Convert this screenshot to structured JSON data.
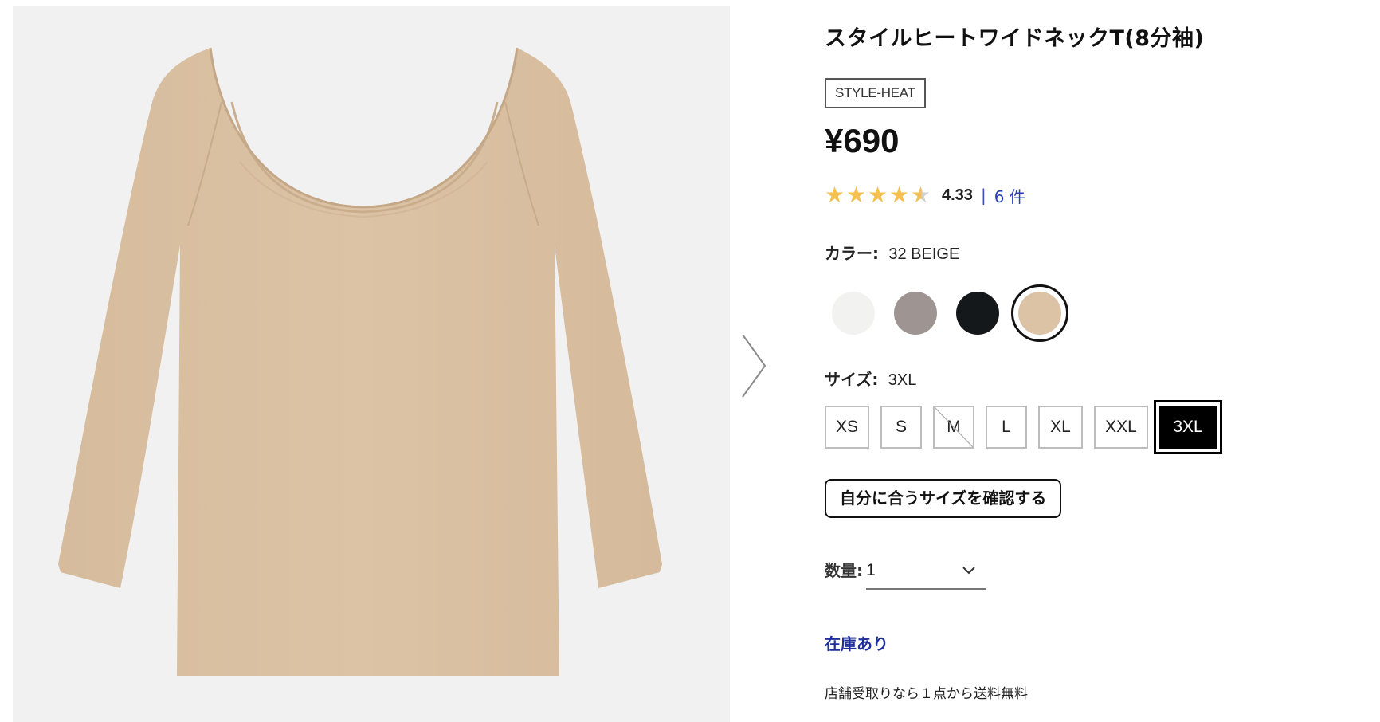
{
  "product": {
    "title": "スタイルヒートワイドネックT(8分袖)",
    "tag": "STYLE-HEAT",
    "price": "¥690",
    "rating": {
      "value": "4.33",
      "stars": 4.33,
      "separator": "|",
      "count": "6 件"
    }
  },
  "color": {
    "label": "カラー:",
    "selected": "32 BEIGE",
    "options": [
      {
        "hex": "#f2f2f0",
        "selected": false
      },
      {
        "hex": "#9e9592",
        "selected": false
      },
      {
        "hex": "#15181b",
        "selected": false
      },
      {
        "hex": "#dcc3a5",
        "selected": true
      }
    ]
  },
  "size": {
    "label": "サイズ:",
    "selected": "3XL",
    "options": [
      {
        "label": "XS",
        "out_of_stock": false,
        "selected": false
      },
      {
        "label": "S",
        "out_of_stock": false,
        "selected": false
      },
      {
        "label": "M",
        "out_of_stock": true,
        "selected": false
      },
      {
        "label": "L",
        "out_of_stock": false,
        "selected": false
      },
      {
        "label": "XL",
        "out_of_stock": false,
        "selected": false
      },
      {
        "label": "XXL",
        "out_of_stock": false,
        "selected": false
      },
      {
        "label": "3XL",
        "out_of_stock": false,
        "selected": true
      }
    ]
  },
  "fit_button": "自分に合うサイズを確認する",
  "quantity": {
    "label": "数量:",
    "value": "1"
  },
  "stock_status": "在庫あり",
  "pickup_note": "店舗受取りなら１点から送料無料",
  "colors": {
    "image_bg": "#f1f1f1",
    "garment": "#dcc3a5",
    "link": "#2b3fb5",
    "stock": "#1f2f9c"
  },
  "icons": [
    "chevron-right-icon",
    "star-icon",
    "chevron-down-icon"
  ]
}
